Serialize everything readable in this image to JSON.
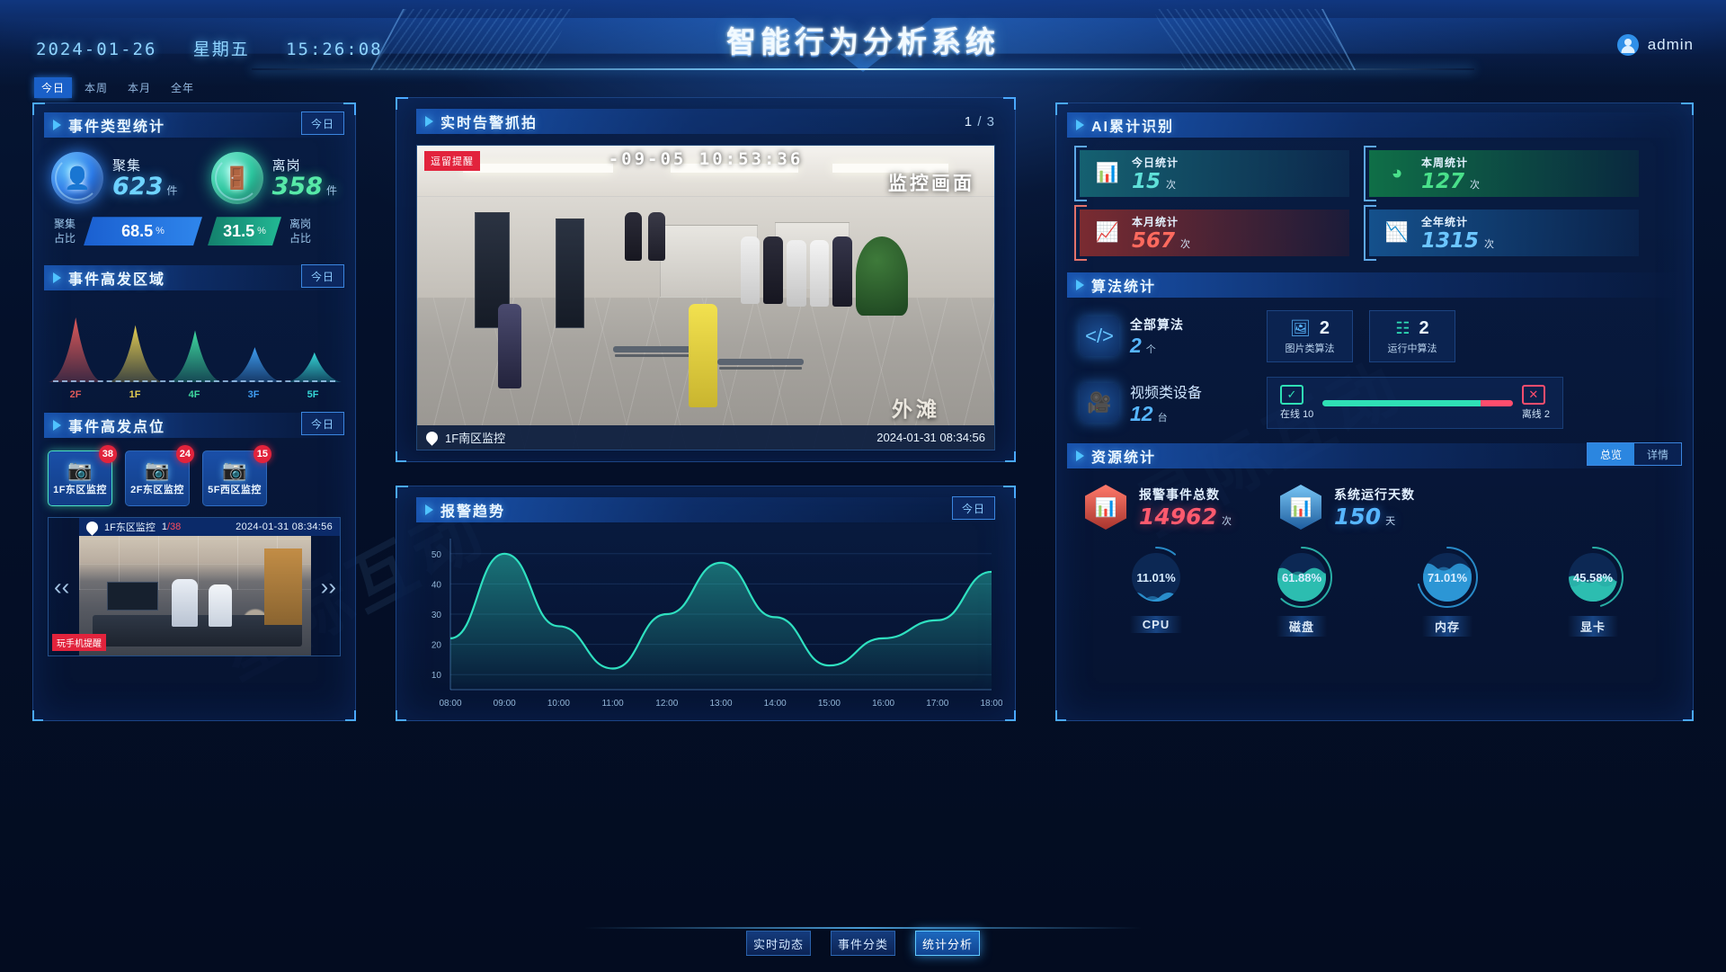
{
  "header": {
    "date": "2024-01-26",
    "weekday": "星期五",
    "time": "15:26:08",
    "title": "智能行为分析系统",
    "user": "admin"
  },
  "tabs": [
    {
      "label": "今日",
      "active": true
    },
    {
      "label": "本周",
      "active": false
    },
    {
      "label": "本月",
      "active": false
    },
    {
      "label": "全年",
      "active": false
    }
  ],
  "left": {
    "event_type": {
      "title": "事件类型统计",
      "badge": "今日",
      "items": [
        {
          "name": "聚集",
          "value": "623",
          "unit": "件",
          "icon": "people-icon",
          "color": "#6fd4ff"
        },
        {
          "name": "离岗",
          "value": "358",
          "unit": "件",
          "icon": "exit-door-icon",
          "color": "#57e9a8"
        }
      ],
      "ratio": {
        "left_caption_top": "聚集",
        "left_caption_bottom": "占比",
        "left_value": "68.5",
        "left_pct": "%",
        "right_value": "31.5",
        "right_pct": "%",
        "right_caption_top": "离岗",
        "right_caption_bottom": "占比"
      }
    },
    "hot_area": {
      "title": "事件高发区域",
      "badge": "今日",
      "chart": {
        "type": "area",
        "categories": [
          "2F",
          "1F",
          "4F",
          "3F",
          "5F"
        ],
        "values": [
          100,
          88,
          80,
          54,
          46
        ],
        "colors": [
          "#e05a5a",
          "#e3cc52",
          "#3fd9a0",
          "#3f9cf0",
          "#35d6d6"
        ],
        "title": "事件高发区域",
        "xlabel": "",
        "ylabel": "",
        "ylim": [
          0,
          100
        ]
      }
    },
    "hot_spots": {
      "title": "事件高发点位",
      "badge": "今日",
      "cards": [
        {
          "name": "1F东区监控",
          "count": "38",
          "selected": true
        },
        {
          "name": "2F东区监控",
          "count": "24",
          "selected": false
        },
        {
          "name": "5F西区监控",
          "count": "15",
          "selected": false
        }
      ],
      "preview": {
        "location": "1F东区监控",
        "index": "1",
        "total": "/38",
        "timestamp": "2024-01-31 08:34:56",
        "tag": "玩手机提醒",
        "prev_icon": "chevron-left-icon",
        "next_icon": "chevron-right-icon"
      }
    }
  },
  "center": {
    "live": {
      "title": "实时告警抓拍",
      "counter": "1",
      "counter_total": "/ 3",
      "alert_tag": "逗留提醒",
      "overlay_timestamp": "-09-05       10:53:36",
      "watermark": "监控画面",
      "watermark2": "外滩",
      "location": "1F南区监控",
      "timestamp": "2024-01-31 08:34:56",
      "pin_icon": "location-pin-icon"
    },
    "trend": {
      "title": "报警趋势",
      "badge": "今日",
      "chart": {
        "type": "line",
        "title": "报警趋势",
        "x": [
          "08:00",
          "09:00",
          "10:00",
          "11:00",
          "12:00",
          "13:00",
          "14:00",
          "15:00",
          "16:00",
          "17:00",
          "18:00"
        ],
        "values": [
          22,
          50,
          26,
          12,
          30,
          47,
          29,
          13,
          22,
          28,
          44
        ],
        "yticks": [
          10,
          20,
          30,
          40,
          50
        ],
        "ylim": [
          5,
          55
        ],
        "xlabel": "",
        "ylabel": "",
        "line_color": "#2fe0c0",
        "grid": true,
        "legend": ""
      }
    }
  },
  "right": {
    "ai_recognition": {
      "title": "AI累计识别",
      "cards": [
        {
          "label": "今日统计",
          "value": "15",
          "unit": "次",
          "icon": "bar-chart-icon",
          "theme": "c-today",
          "color": "#5fe0d8"
        },
        {
          "label": "本周统计",
          "value": "127",
          "unit": "次",
          "icon": "pie-chart-icon",
          "theme": "c-week",
          "color": "#49e08a"
        },
        {
          "label": "本月统计",
          "value": "567",
          "unit": "次",
          "icon": "line-chart-icon",
          "theme": "c-month",
          "color": "#ff6a5e"
        },
        {
          "label": "全年统计",
          "value": "1315",
          "unit": "次",
          "icon": "trend-chart-icon",
          "theme": "c-year",
          "color": "#6cc6ff"
        }
      ]
    },
    "algorithm": {
      "title": "算法统计",
      "main": {
        "label": "全部算法",
        "value": "2",
        "unit": "个",
        "icon": "code-window-icon"
      },
      "boxes": [
        {
          "label": "图片类算法",
          "value": "2",
          "icon": "image-icon",
          "color": "#5ab8ff"
        },
        {
          "label": "运行中算法",
          "value": "2",
          "icon": "code-icon",
          "color": "#2fe0b5"
        }
      ],
      "device": {
        "label": "视频类设备",
        "value": "12",
        "unit": "台",
        "icon": "video-camera-icon",
        "online_label": "在线",
        "online_value": "10",
        "offline_label": "离线",
        "offline_value": "2",
        "online_icon": "monitor-check-icon",
        "offline_icon": "monitor-x-icon"
      }
    },
    "resource": {
      "title": "资源统计",
      "toggle": [
        {
          "label": "总览",
          "active": true
        },
        {
          "label": "详情",
          "active": false
        }
      ],
      "stats": [
        {
          "label": "报警事件总数",
          "value": "14962",
          "unit": "次",
          "icon": "alert-chart-icon",
          "color": "#ff5a6e"
        },
        {
          "label": "系统运行天数",
          "value": "150",
          "unit": "天",
          "icon": "system-chart-icon",
          "color": "#57b6ff"
        }
      ],
      "gauges": [
        {
          "label": "CPU",
          "value": "11.01%",
          "pct": 11.01,
          "color": "#2f9fe0"
        },
        {
          "label": "磁盘",
          "value": "61.88%",
          "pct": 61.88,
          "color": "#2fc9b8"
        },
        {
          "label": "内存",
          "value": "71.01%",
          "pct": 71.01,
          "color": "#2f9fe0"
        },
        {
          "label": "显卡",
          "value": "45.58%",
          "pct": 45.58,
          "color": "#2fc9b8"
        }
      ]
    }
  },
  "bottom_nav": [
    {
      "label": "实时动态",
      "active": false
    },
    {
      "label": "事件分类",
      "active": false
    },
    {
      "label": "统计分析",
      "active": true
    }
  ],
  "watermark_text": "星际互动"
}
